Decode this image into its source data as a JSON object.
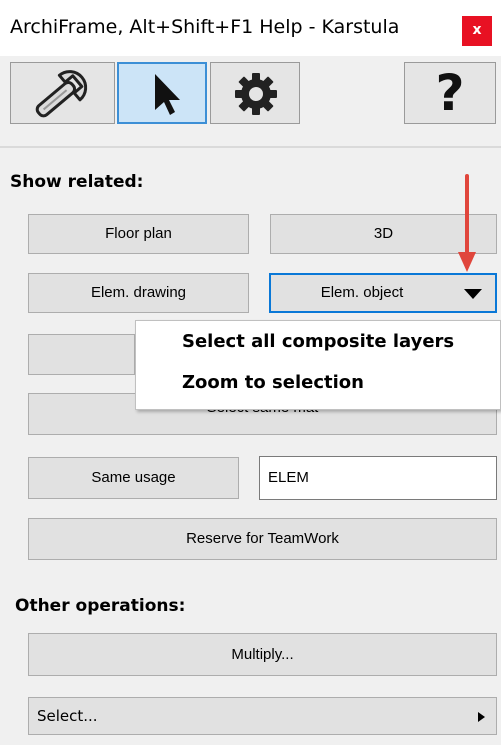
{
  "window": {
    "title": "ArchiFrame, Alt+Shift+F1 Help - Karstula",
    "close_label": "x"
  },
  "toolbar": {
    "icons": [
      "wrench-icon",
      "pointer-arrow-icon",
      "gear-icon",
      "help-question-icon"
    ],
    "help_label": "?",
    "active_tab": "pointer-arrow-icon"
  },
  "show_related": {
    "heading": "Show related:",
    "floor_plan": "Floor plan",
    "three_d": "3D",
    "elem_drawing": "Elem. drawing",
    "elem_object": "Elem. object",
    "select_same_mat": "Select same mat",
    "same_usage": "Same usage",
    "usage_value": "ELEM",
    "reserve": "Reserve for TeamWork"
  },
  "dropdown_menu": {
    "items": [
      "Select all composite layers",
      "Zoom to selection"
    ]
  },
  "other_operations": {
    "heading": "Other operations:",
    "multiply": "Multiply...",
    "select": "Select..."
  },
  "colors": {
    "close_bg": "#e81123",
    "active_tab_bg": "#cce4f7",
    "active_tab_border": "#3c8fd6",
    "selected_button_border": "#0a78d7",
    "annotation_arrow": "#e0463c"
  }
}
